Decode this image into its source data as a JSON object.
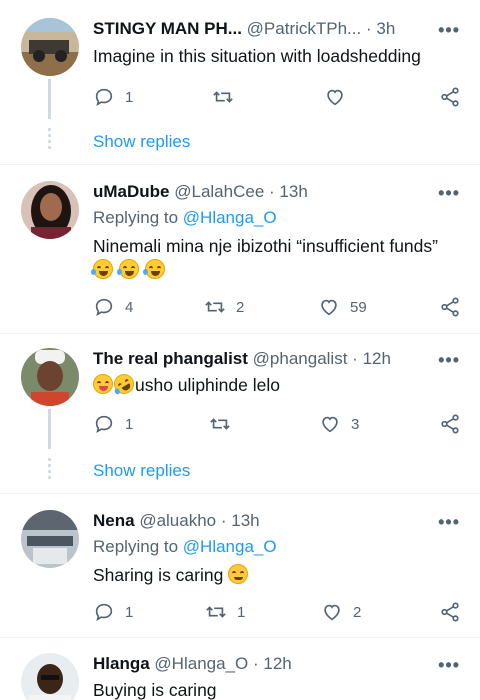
{
  "tweets": [
    {
      "name": "STINGY MAN PH...",
      "handle": "@PatrickTPh...",
      "sep": "·",
      "time": "3h",
      "more": "•••",
      "text": "Imagine in this situation with loadshedding",
      "replies": "1",
      "retweets": "",
      "likes": "",
      "show_replies": "Show replies"
    },
    {
      "name": "uMaDube",
      "handle": "@LalahCee",
      "sep": "·",
      "time": "13h",
      "more": "•••",
      "replying_prefix": "Replying to ",
      "replying_to": "@Hlanga_O",
      "text": "Ninemali mina nje ibizothi “insufficient funds”",
      "emoji": [
        "joy-emoji",
        "joy-emoji",
        "joy-emoji"
      ],
      "replies": "4",
      "retweets": "2",
      "likes": "59"
    },
    {
      "name": "The real phangalist",
      "handle": "@phangalist",
      "sep": "·",
      "time": "12h",
      "more": "•••",
      "text": "usho uliphinde lelo",
      "emoji": [
        "winking-tongue-emoji",
        "rofl-emoji"
      ],
      "replies": "1",
      "retweets": "",
      "likes": "3",
      "show_replies": "Show replies"
    },
    {
      "name": "Nena",
      "handle": "@aluakho",
      "sep": "·",
      "time": "13h",
      "more": "•••",
      "replying_prefix": "Replying to ",
      "replying_to": "@Hlanga_O",
      "text": "Sharing is caring",
      "emoji": [
        "smiling-emoji"
      ],
      "replies": "1",
      "retweets": "1",
      "likes": "2"
    },
    {
      "name": "Hlanga",
      "handle": "@Hlanga_O",
      "sep": "·",
      "time": "12h",
      "more": "•••",
      "text": "Buying is caring"
    }
  ],
  "colors": {
    "accent": "#1d9bf0",
    "secondary_text": "#536471",
    "thread_line": "#cfd9de",
    "divider": "#eff3f4"
  },
  "icons": [
    "reply-icon",
    "retweet-icon",
    "like-icon",
    "share-icon",
    "more-icon"
  ]
}
